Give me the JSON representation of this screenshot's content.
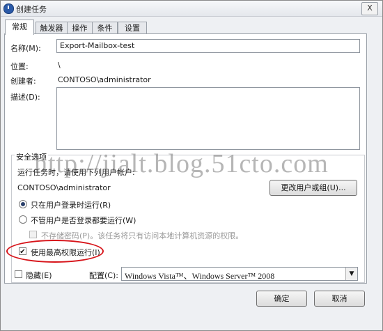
{
  "window": {
    "title": "创建任务",
    "close_label": "X"
  },
  "tabs": [
    {
      "label": "常规",
      "active": true
    },
    {
      "label": "触发器"
    },
    {
      "label": "操作"
    },
    {
      "label": "条件"
    },
    {
      "label": "设置"
    }
  ],
  "general": {
    "name_label": "名称(M):",
    "name_value": "Export-Mailbox-test",
    "location_label": "位置:",
    "location_value": "\\",
    "author_label": "创建者:",
    "author_value": "CONTOSO\\administrator",
    "description_label": "描述(D):",
    "description_value": ""
  },
  "security": {
    "group_title": "安全选项",
    "run_as_label": "运行任务时，请使用下列用户帐户:",
    "user_account": "CONTOSO\\administrator",
    "change_user_button": "更改用户或组(U)...",
    "radio_logged_on": "只在用户登录时运行(R)",
    "radio_any": "不管用户是否登录都要运行(W)",
    "no_store_password": "不存储密码(P)。该任务将只有访问本地计算机资源的权限。",
    "highest_privileges": "使用最高权限运行(I)"
  },
  "bottom": {
    "hidden_label": "隐藏(E)",
    "configure_label": "配置(C):",
    "configure_value": "Windows Vista™、Windows Server™ 2008",
    "ok_button": "确定",
    "cancel_button": "取消"
  },
  "watermark": "http://jialt.blog.51cto.com",
  "colors": {
    "annotation": "#d7141a"
  }
}
